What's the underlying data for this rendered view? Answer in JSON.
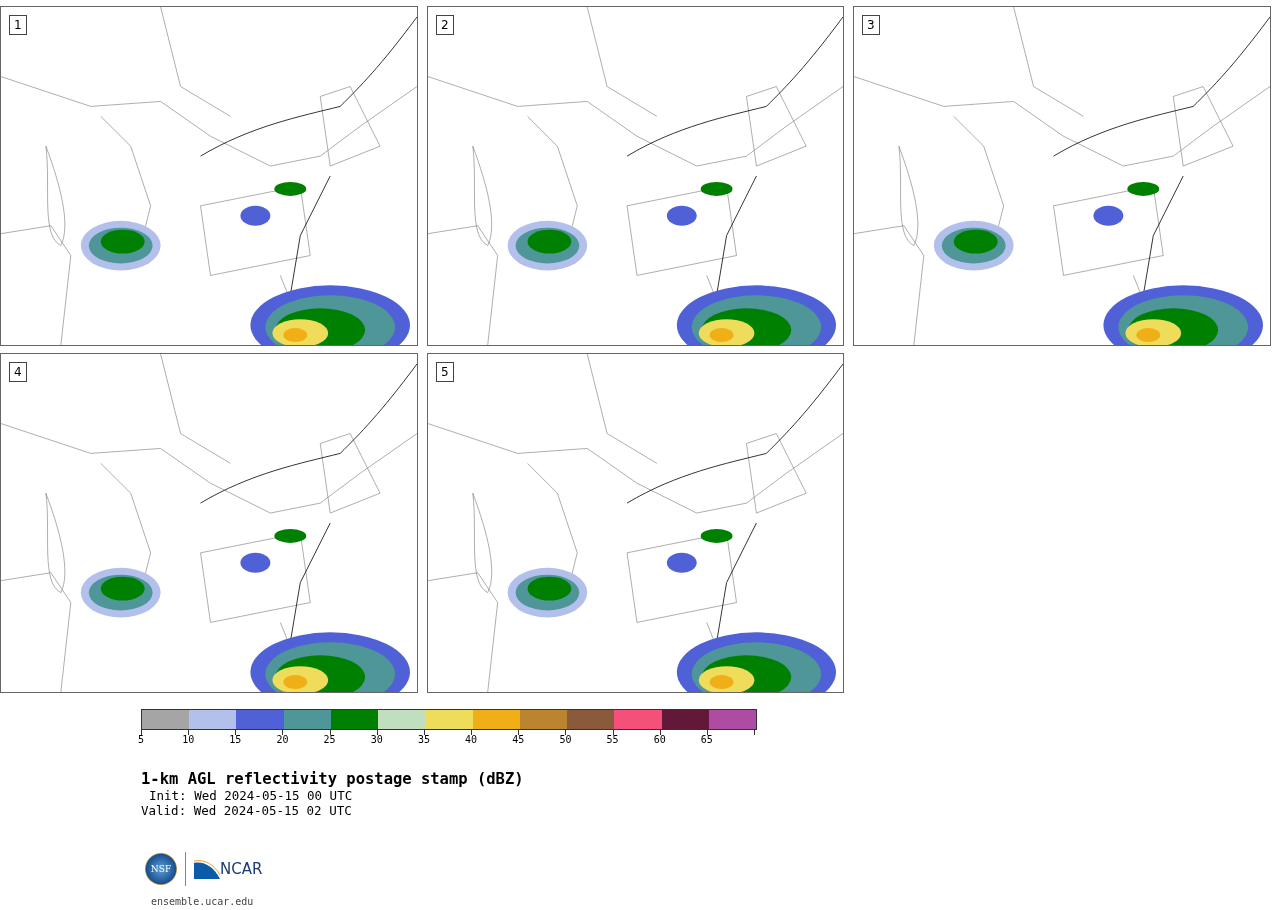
{
  "panels": [
    {
      "label": "1"
    },
    {
      "label": "2"
    },
    {
      "label": "3"
    },
    {
      "label": "4"
    },
    {
      "label": "5"
    }
  ],
  "colorbar": {
    "segments": [
      {
        "color": "#a5a5a5"
      },
      {
        "color": "#b4c0ec"
      },
      {
        "color": "#5060d6"
      },
      {
        "color": "#4f9699"
      },
      {
        "color": "#008000"
      },
      {
        "color": "#bfdfbf"
      },
      {
        "color": "#efdc5a"
      },
      {
        "color": "#f0af16"
      },
      {
        "color": "#bb842f"
      },
      {
        "color": "#8b5a3c"
      },
      {
        "color": "#f55079"
      },
      {
        "color": "#621839"
      },
      {
        "color": "#ae4ba3"
      }
    ],
    "ticks": [
      "5",
      "10",
      "15",
      "20",
      "25",
      "30",
      "35",
      "40",
      "45",
      "50",
      "55",
      "60",
      "65"
    ]
  },
  "title": "1-km AGL reflectivity postage stamp (dBZ)",
  "init": "Init: Wed 2024-05-15 00 UTC",
  "valid": "Valid: Wed 2024-05-15 02 UTC",
  "logo": {
    "left": "NSF",
    "right": "NCAR"
  },
  "url": "ensemble.ucar.edu"
}
